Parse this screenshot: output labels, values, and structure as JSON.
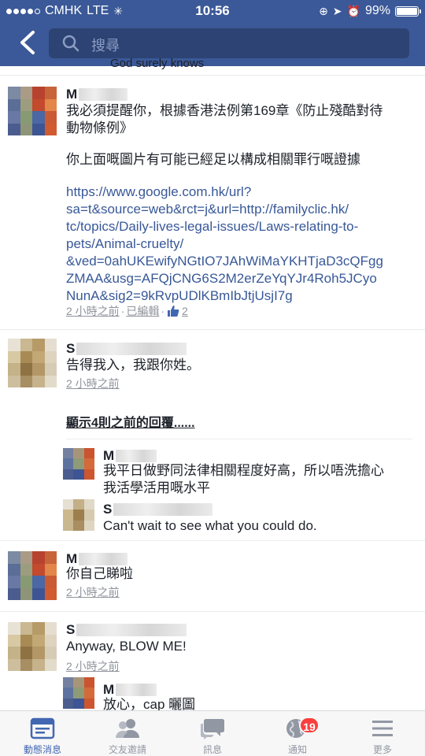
{
  "status_bar": {
    "carrier": "CMHK",
    "network": "LTE",
    "time": "10:56",
    "battery": "99%"
  },
  "search": {
    "placeholder": "搜尋"
  },
  "cutoff_text": "God surely knows",
  "comments": [
    {
      "name_initial": "M",
      "text_lines": [
        "我必須提醒你，根據香港法例第169章《防止殘酷對待",
        "動物條例》"
      ],
      "text2": "你上面嘅圖片有可能已經足以構成相關罪行嘅證據",
      "link_lines": [
        "https://www.google.com.hk/url?",
        "sa=t&source=web&rct=j&url=http://familyclic.hk/",
        "tc/topics/Daily-lives-legal-issues/Laws-relating-to-",
        "pets/Animal-cruelty/",
        "&ved=0ahUKEwifyNGtIO7JAhWiMaYKHTjaD3cQFgg",
        "ZMAA&usg=AFQjCNG6S2M2erZeYqYJr4Roh5JCyo",
        "NunA&sig2=9kRvpUDlKBmIbJtjUsjI7g"
      ],
      "time": "2 小時之前",
      "edited": "已編輯",
      "likes": "2"
    },
    {
      "name_initial": "S",
      "text": "告得我入，我跟你姓。",
      "time": "2 小時之前"
    },
    {
      "name_initial": "M",
      "text": "你自己睇啦",
      "time": "2 小時之前"
    },
    {
      "name_initial": "S",
      "text": "Anyway, BLOW ME!",
      "time": "2 小時之前"
    }
  ],
  "previous_replies": "顯示4則之前的回覆......",
  "replies": [
    {
      "name_initial": "M",
      "text_lines": [
        "我平日做野同法律相關程度好高，所以唔洗擔心",
        "我活學活用嘅水平"
      ]
    },
    {
      "name_initial": "S",
      "text": "Can't wait to see what you could do."
    },
    {
      "name_initial": "M",
      "text": "放心，cap 曬圖"
    }
  ],
  "tabs": [
    {
      "label": "動態消息",
      "icon": "news-feed-icon",
      "active": true
    },
    {
      "label": "交友邀請",
      "icon": "friend-requests-icon"
    },
    {
      "label": "訊息",
      "icon": "messages-icon"
    },
    {
      "label": "通知",
      "icon": "globe-notifications-icon",
      "badge": "19"
    },
    {
      "label": "更多",
      "icon": "menu-icon"
    }
  ],
  "colors": {
    "header": "#3b5998",
    "link": "#385898",
    "badge": "#fa3e3e",
    "active_tab": "#4267b2"
  }
}
